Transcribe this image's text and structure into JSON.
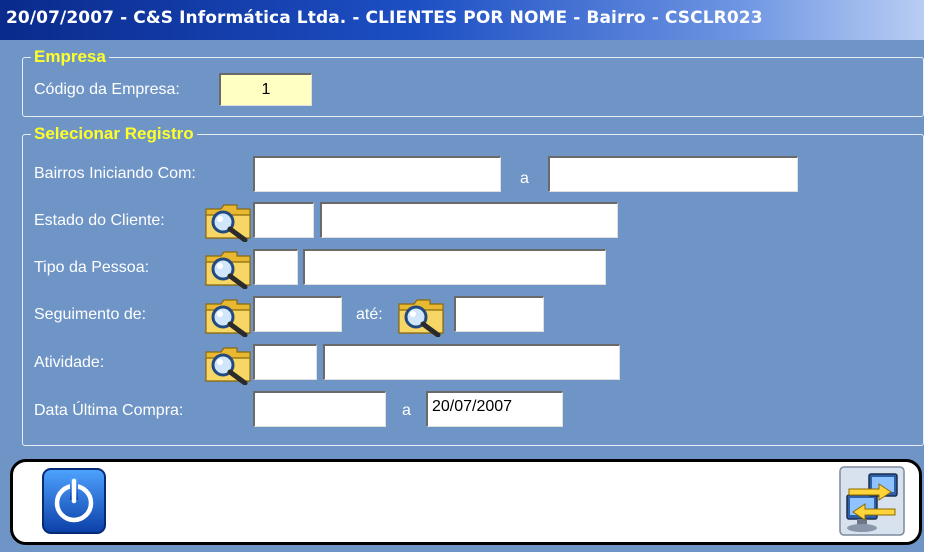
{
  "title": "20/07/2007 - C&S Informática Ltda. - CLIENTES POR NOME - Bairro - CSCLR023",
  "empresa": {
    "legend": "Empresa",
    "codigo_label": "Código da Empresa:",
    "codigo_value": "1"
  },
  "registro": {
    "legend": "Selecionar Registro",
    "bairros_label": "Bairros Iniciando Com:",
    "bairros_sep": "a",
    "bairros_from": "",
    "bairros_to": "",
    "estado_label": "Estado do Cliente:",
    "estado_code": "",
    "estado_desc": "",
    "tipo_label": "Tipo da Pessoa:",
    "tipo_code": "",
    "tipo_desc": "",
    "seguimento_label": "Seguimento de:",
    "seguimento_ate": "até:",
    "seguimento_from": "",
    "seguimento_to": "",
    "atividade_label": "Atividade:",
    "atividade_code": "",
    "atividade_desc": "",
    "data_label": "Data Última Compra:",
    "data_sep": "a",
    "data_from": "",
    "data_to": "20/07/2007"
  },
  "icons": {
    "lookup": "folder-magnifier-icon",
    "exit": "power-icon",
    "transfer": "computers-exchange-icon"
  },
  "colors": {
    "panel": "#6f95c6",
    "title_start": "#0a2a8c",
    "legend": "#ffff2a",
    "readonly_field": "#ffffc4"
  }
}
